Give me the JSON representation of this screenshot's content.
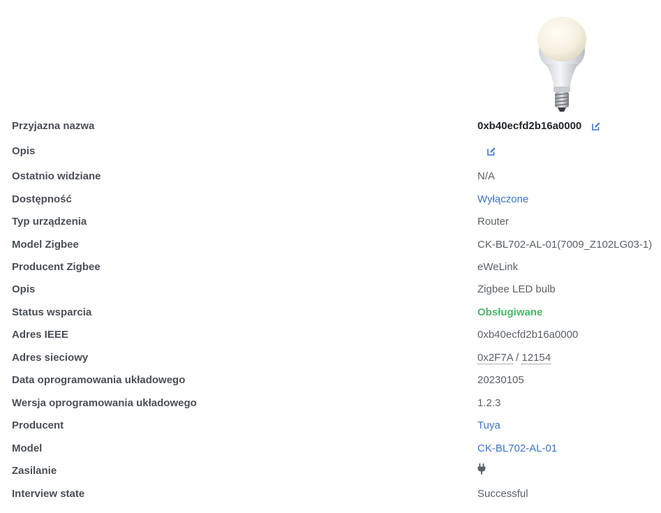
{
  "device_image": {
    "icon": "light-bulb-icon"
  },
  "rows": [
    {
      "key": "Przyjazna nazwa",
      "value": "0xb40ecfd2b16a0000"
    },
    {
      "key": "Opis",
      "value": ""
    },
    {
      "key": "Ostatnio widziane",
      "value": "N/A"
    },
    {
      "key": "Dostępność",
      "value": "Wyłączone"
    },
    {
      "key": "Typ urządzenia",
      "value": "Router"
    },
    {
      "key": "Model Zigbee",
      "value": "CK-BL702-AL-01(7009_Z102LG03-1)"
    },
    {
      "key": "Producent Zigbee",
      "value": "eWeLink"
    },
    {
      "key": "Opis",
      "value": "Zigbee LED bulb"
    },
    {
      "key": "Status wsparcia",
      "value": "Obsługiwane"
    },
    {
      "key": "Adres IEEE",
      "value": "0xb40ecfd2b16a0000"
    },
    {
      "key": "Adres sieciowy",
      "value": "0x2F7A",
      "value2": "12154",
      "separator": " / "
    },
    {
      "key": "Data oprogramowania układowego",
      "value": "20230105"
    },
    {
      "key": "Wersja oprogramowania układowego",
      "value": "1.2.3"
    },
    {
      "key": "Producent",
      "value": "Tuya"
    },
    {
      "key": "Model",
      "value": "CK-BL702-AL-01"
    },
    {
      "key": "Zasilanie",
      "value": "",
      "icon": "power-plug-icon"
    },
    {
      "key": "Interview state",
      "value": "Successful"
    }
  ],
  "colors": {
    "link": "#3b74cc",
    "supported": "#4cb86a",
    "label": "#4a4f55",
    "value": "#5c6166"
  }
}
